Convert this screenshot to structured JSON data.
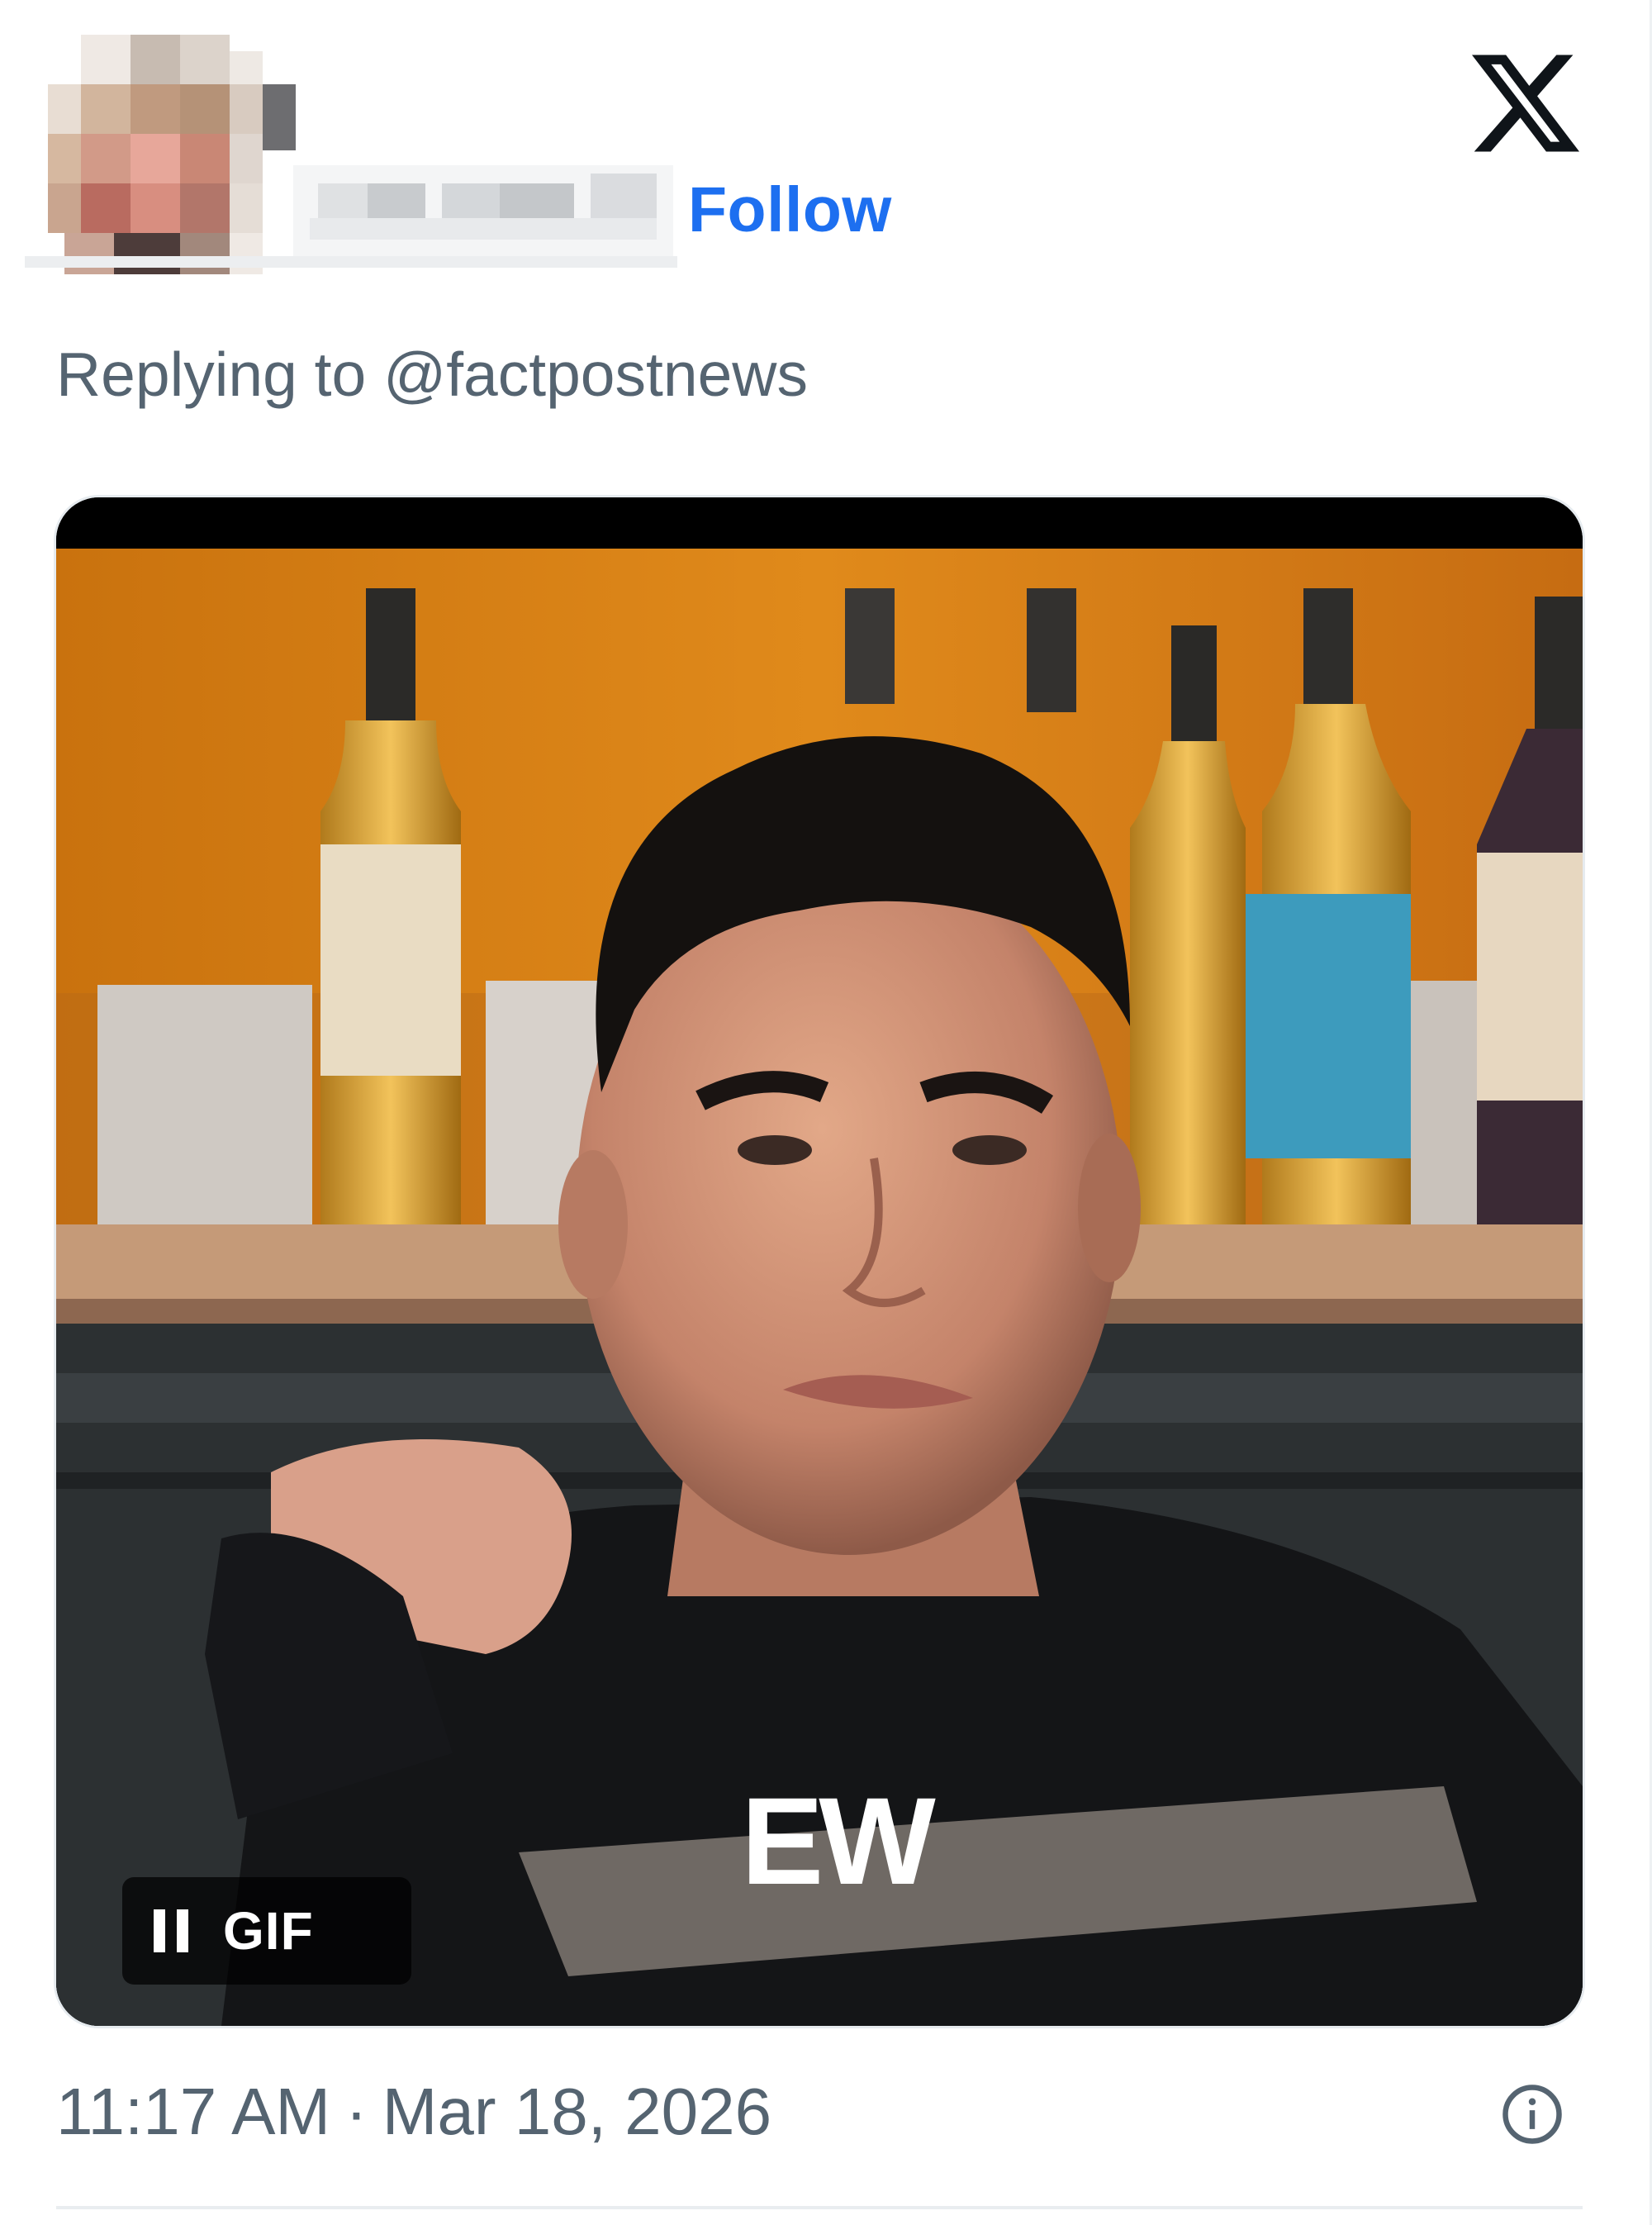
{
  "tweet": {
    "follow_label": "Follow",
    "replying_prefix": "Replying to",
    "replying_handle": "@factpostnews",
    "time": "11:17 AM",
    "separator": "·",
    "date": "Mar 18, 2026"
  },
  "media": {
    "caption": "EW",
    "badge_label": "GIF",
    "pause_icon": "pause-icon"
  },
  "icons": {
    "logo": "x-logo-icon",
    "info": "info-icon"
  },
  "colors": {
    "follow": "#1d6ff0",
    "secondary_text": "#556471",
    "background": "#ffffff"
  }
}
